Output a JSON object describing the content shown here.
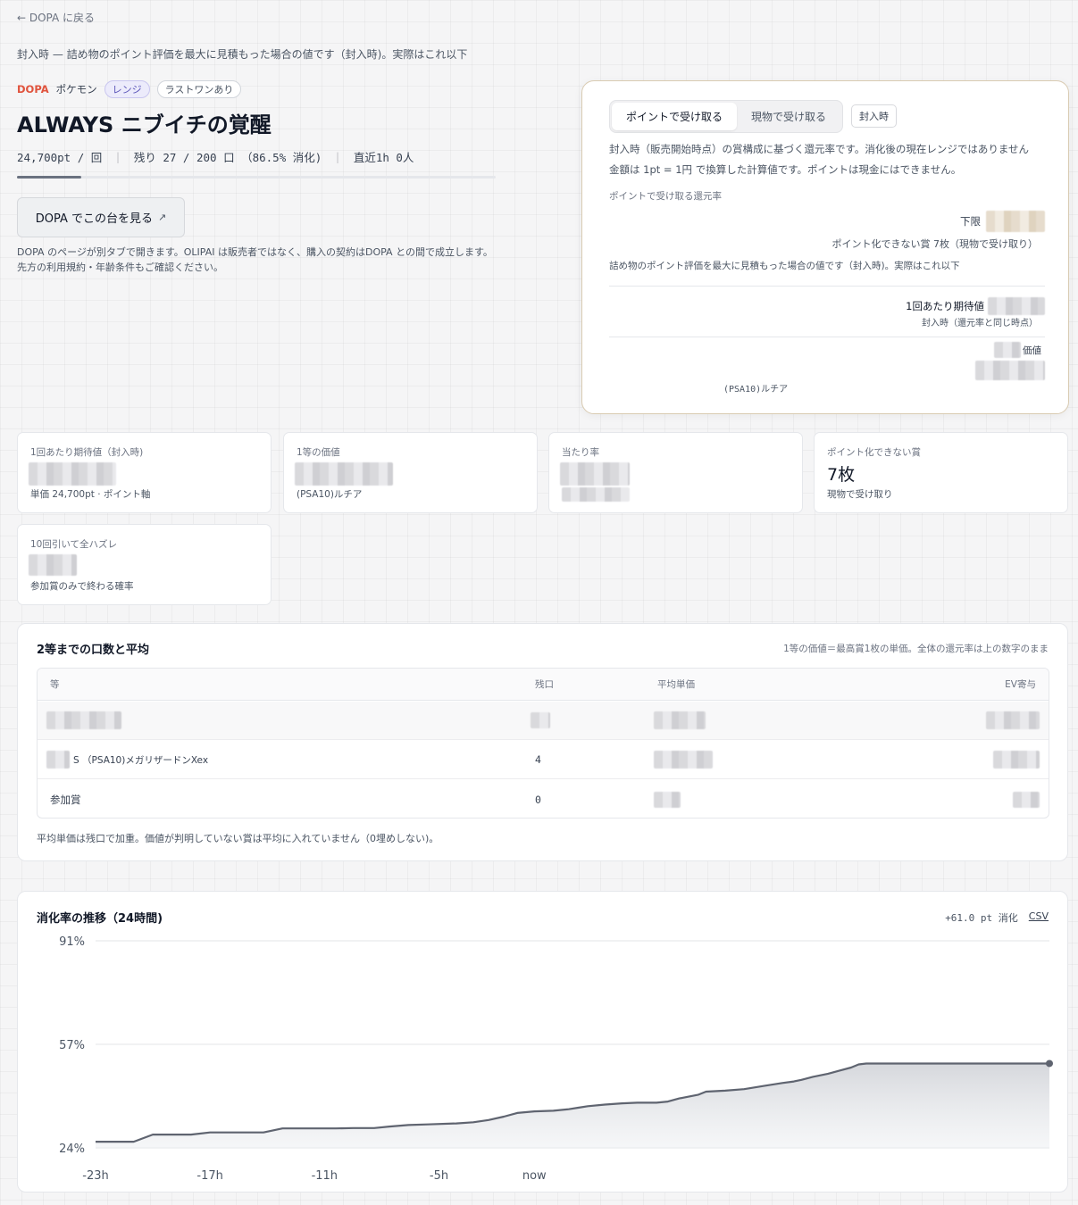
{
  "nav": {
    "back_label": "← DOPA に戻る"
  },
  "top_note": "封入時 — 詰め物のポイント評価を最大に見積もった場合の値です（封入時)。実際はこれ以下",
  "product": {
    "brand": "DOPA",
    "genre": "ポケモン",
    "tags": [
      "レンジ",
      "ラストワンあり"
    ],
    "title": "ALWAYS ニブイチの覚醒",
    "price": "24,700pt / 回",
    "remaining": "残り 27 / 200 口 （86.5% 消化)",
    "recent": "直近1h 0人",
    "progress": 0.135,
    "view_button": "DOPA でこの台を見る",
    "view_icon": "external-link-icon",
    "disclaimer": "DOPA のページが別タブで開きます。OLIPAI は販売者ではなく、購入の契約はDOPA との間で成立します。先方の利用規約・年齢条件もご確認ください。"
  },
  "ev_panel": {
    "tabs": [
      "ポイントで受け取る",
      "現物で受け取る"
    ],
    "active_tab": 0,
    "time_chip": "封入時",
    "text1": "封入時（販売開始時点）の賞構成に基づく還元率です。消化後の現在レンジではありません",
    "text2": "金額は 1pt = 1円 で換算した計算値です。ポイントは現金にはできません。",
    "section_label": "ポイントで受け取る還元率",
    "lower_label": "下限",
    "non_point": "ポイント化できない賞 7枚（現物で受け取り）",
    "note": "詰め物のポイント評価を最大に見積もった場合の値です（封入時)。実際はこれ以下",
    "per_label": "1回あたり期待値",
    "per_sub": "封入時（還元率と同じ時点）",
    "value_label": "価値",
    "top_prize": "(PSA10)ルチア"
  },
  "metrics": [
    {
      "label": "1回あたり期待値（封入時)",
      "sub": "単価 24,700pt · ポイント軸"
    },
    {
      "label": "1等の価値",
      "sub": "(PSA10)ルチア"
    },
    {
      "label": "当たり率",
      "sub": ""
    },
    {
      "label": "ポイント化できない賞",
      "value": "7枚",
      "sub": "現物で受け取り"
    },
    {
      "label": "10回引いて全ハズレ",
      "sub": "参加賞のみで終わる確率"
    }
  ],
  "prize_table": {
    "title": "2等までの口数と平均",
    "note": "1等の価値＝最高賞1枚の単価。全体の還元率は上の数字のまま",
    "columns": [
      "等",
      "残口",
      "平均単価",
      "EV寄与"
    ],
    "rows": [
      {
        "name": "",
        "remaining": ""
      },
      {
        "name": "S （PSA10)メガリザードンXex",
        "remaining": "4"
      },
      {
        "name": "参加賞",
        "remaining": "0"
      }
    ],
    "footnote": "平均単価は残口で加重。価値が判明していない賞は平均に入れていません（0埋めしない)。"
  },
  "chart": {
    "title": "消化率の推移（24時間)",
    "delta": "+61.0 pt 消化",
    "csv_label": "CSV"
  },
  "chart_data": {
    "type": "area",
    "title": "消化率の推移（24時間)",
    "y_ticks": [
      "91%",
      "57%",
      "24%"
    ],
    "ylim": [
      24,
      91
    ],
    "x_ticks": [
      "-23h",
      "-17h",
      "-11h",
      "-5h",
      "now"
    ],
    "xlim": [
      -23,
      0
    ],
    "x_tick_values": [
      -23,
      -17,
      -11,
      -5,
      0
    ],
    "grid": true,
    "series": [
      {
        "x": [
          -23,
          -21,
          -20,
          -18,
          -17,
          -16.3,
          -15.2,
          -14.2,
          -13.2,
          -11.2,
          -10.4,
          -9.5,
          -8.4,
          -7.6,
          -6.6,
          -5.6,
          -4.1,
          -3.2,
          -2.4,
          -1.6,
          -0.9,
          0,
          1.0,
          1.8,
          2.3,
          2.8,
          3.7,
          4.6,
          5.4,
          6.4,
          7.0,
          7.6,
          8.0,
          8.6,
          9.0,
          10.0,
          11.0,
          12.0,
          13.0,
          13.6,
          14.0,
          14.6,
          15.4,
          16.0,
          16.6,
          17.0,
          17.4,
          18.0,
          18.6,
          19.5,
          20.4,
          21.4,
          22.5,
          23.5,
          24.5,
          25.5,
          26.5,
          27.0
        ],
        "y": [
          26.0,
          26.0,
          28.3,
          28.3,
          29.0,
          29.0,
          29.0,
          29.0,
          30.3,
          30.3,
          30.3,
          30.4,
          30.4,
          30.9,
          31.4,
          31.6,
          31.9,
          32.3,
          33.0,
          34.1,
          35.3,
          35.8,
          36.0,
          36.5,
          37.0,
          37.5,
          38.0,
          38.4,
          38.6,
          38.6,
          39.0,
          40.0,
          40.5,
          41.2,
          42.2,
          42.5,
          43.0,
          44.0,
          45.0,
          45.5,
          46.0,
          47.0,
          48.0,
          49.0,
          50.0,
          51.0,
          51.3,
          51.3,
          51.3,
          51.3,
          51.3,
          51.3,
          51.3,
          51.3,
          51.3,
          51.3,
          51.3,
          51.3
        ],
        "note": "approximate"
      }
    ]
  }
}
